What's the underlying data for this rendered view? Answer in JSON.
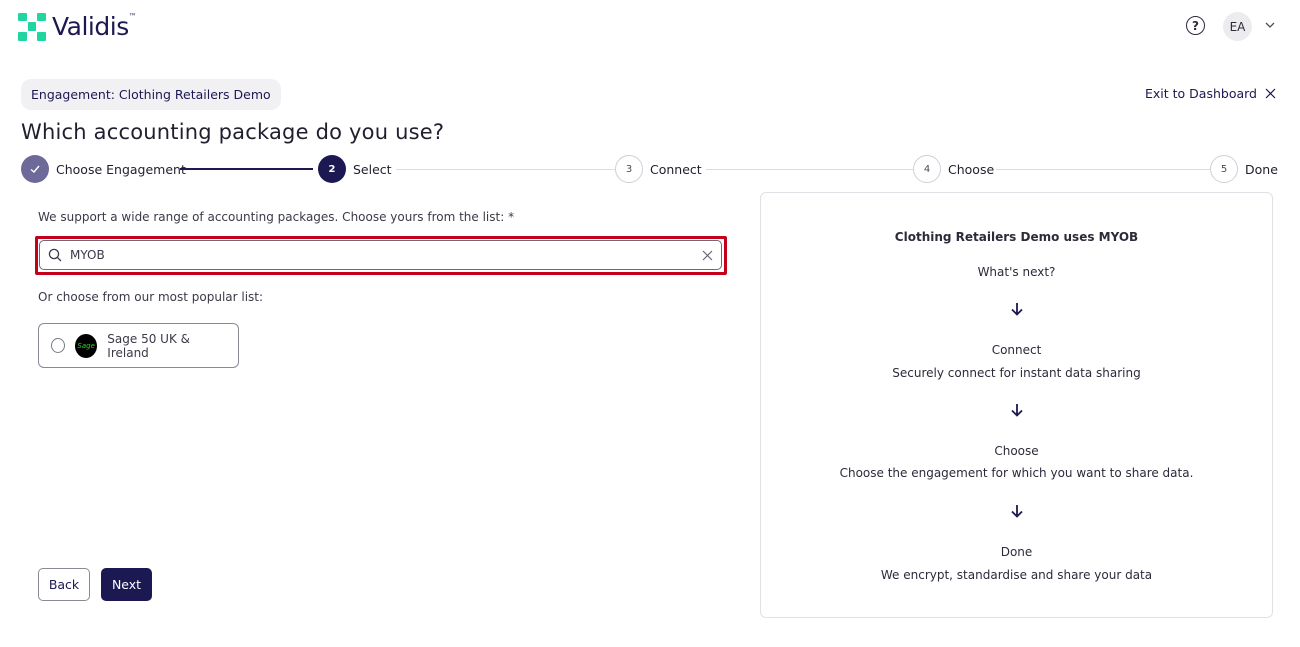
{
  "header": {
    "logo_text": "Validis",
    "logo_tm": "™",
    "help_glyph": "?",
    "avatar_initials": "EA"
  },
  "engagement": {
    "pill_label": "Engagement: Clothing Retailers Demo",
    "exit_label": "Exit to Dashboard"
  },
  "page": {
    "title": "Which accounting package do you use?"
  },
  "stepper": {
    "steps": [
      {
        "number": "",
        "label": "Choose Engagement",
        "state": "done"
      },
      {
        "number": "2",
        "label": "Select",
        "state": "active"
      },
      {
        "number": "3",
        "label": "Connect",
        "state": "todo"
      },
      {
        "number": "4",
        "label": "Choose",
        "state": "todo"
      },
      {
        "number": "5",
        "label": "Done",
        "state": "todo"
      }
    ]
  },
  "select": {
    "support_text": "We support a wide range of accounting packages. Choose yours from the list: *",
    "search_value": "MYOB",
    "popular_text": "Or choose from our most popular list:",
    "options": [
      {
        "label": "Sage 50 UK & Ireland",
        "logo_text": "Sage"
      }
    ]
  },
  "actions": {
    "back_label": "Back",
    "next_label": "Next"
  },
  "info": {
    "heading": "Clothing Retailers Demo uses MYOB",
    "subheading": "What's next?",
    "steps": [
      {
        "title": "Connect",
        "description": "Securely connect for instant data sharing"
      },
      {
        "title": "Choose",
        "description": "Choose the engagement for which you want to share data."
      },
      {
        "title": "Done",
        "description": "We encrypt, standardise and share your data"
      }
    ]
  },
  "colors": {
    "brand_navy": "#1c1852",
    "brand_green": "#1fd6a0",
    "highlight_red": "#c4001a"
  }
}
